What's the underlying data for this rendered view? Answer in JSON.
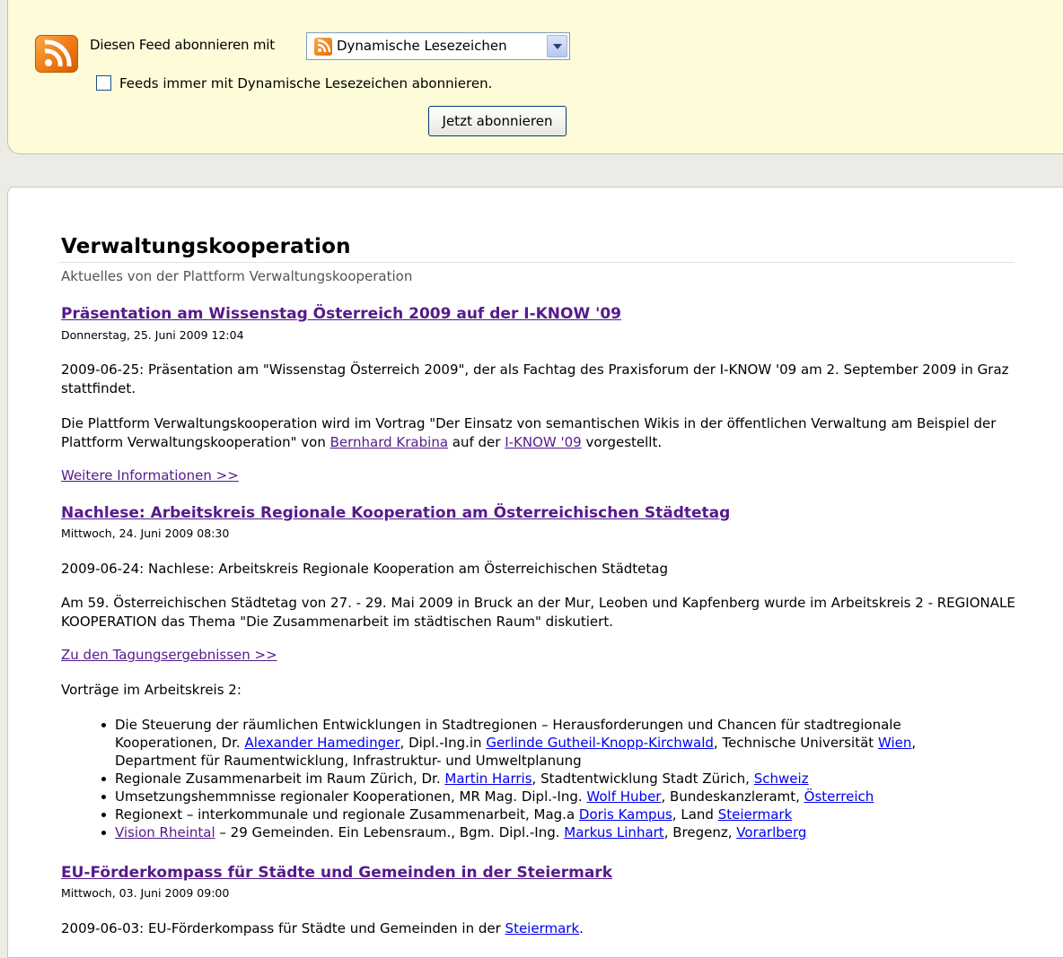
{
  "subscribe": {
    "label": "Diesen Feed abonnieren mit",
    "selected_reader": "Dynamische Lesezeichen",
    "always_label": "Feeds immer mit Dynamische Lesezeichen abonnieren.",
    "button_label": "Jetzt abonnieren"
  },
  "feed": {
    "title": "Verwaltungskooperation",
    "subtitle": "Aktuelles von der Plattform Verwaltungskooperation"
  },
  "entries": [
    {
      "title": "Präsentation am Wissenstag Österreich 2009 auf der I-KNOW '09",
      "date": "Donnerstag, 25. Juni 2009 12:04",
      "p1": "2009-06-25: Präsentation am \"Wissenstag Österreich 2009\", der als Fachtag des Praxisforum der I-KNOW '09 am 2. September 2009 in Graz stattfindet.",
      "p2_a": "Die Plattform Verwaltungskooperation wird im Vortrag \"Der Einsatz von semantischen Wikis in der öffentlichen Verwaltung am Beispiel der Plattform Verwaltungskooperation\" von ",
      "p2_link1": "Bernhard Krabina",
      "p2_b": " auf der ",
      "p2_link2": "I-KNOW '09",
      "p2_c": " vorgestellt.",
      "more_link": "Weitere Informationen >>"
    },
    {
      "title": "Nachlese: Arbeitskreis Regionale Kooperation am Österreichischen Städtetag",
      "date": "Mittwoch, 24. Juni 2009 08:30",
      "p1": "2009-06-24: Nachlese: Arbeitskreis Regionale Kooperation am Österreichischen Städtetag",
      "p2": "Am 59. Österreichischen Städtetag von 27. - 29. Mai 2009 in Bruck an der Mur, Leoben und Kapfenberg wurde im Arbeitskreis 2 - REGIONALE KOOPERATION das Thema \"Die Zusammenarbeit im städtischen Raum\" diskutiert.",
      "results_link": "Zu den Tagungsergebnissen >>",
      "talks_heading": "Vorträge im Arbeitskreis 2:",
      "talks": [
        {
          "a": "Die Steuerung der räumlichen Entwicklungen in Stadtregionen – Herausforderungen und Chancen für stadtregionale Kooperationen, Dr. ",
          "l1": "Alexander Hamedinger",
          "b": ", Dipl.-Ing.in ",
          "l2": "Gerlinde Gutheil-Knopp-Kirchwald",
          "c": ", Technische Universität ",
          "l3": "Wien",
          "d": ", Department für Raumentwicklung, Infrastruktur- und Umweltplanung"
        },
        {
          "a": "Regionale Zusammenarbeit im Raum Zürich, Dr. ",
          "l1": "Martin Harris",
          "b": ", Stadtentwicklung Stadt Zürich, ",
          "l2": "Schweiz"
        },
        {
          "a": "Umsetzungshemmnisse regionaler Kooperationen, MR Mag. Dipl.-Ing. ",
          "l1": "Wolf Huber",
          "b": ", Bundeskanzleramt, ",
          "l2": "Österreich"
        },
        {
          "a": "Regionext – interkommunale und regionale Zusammenarbeit, Mag.a ",
          "l1": "Doris Kampus",
          "b": ", Land ",
          "l2": "Steiermark"
        },
        {
          "l0": "Vision Rheintal",
          "a": " – 29 Gemeinden. Ein Lebensraum., Bgm. Dipl.-Ing. ",
          "l1": "Markus Linhart",
          "b": ", Bregenz, ",
          "l2": "Vorarlberg"
        }
      ]
    },
    {
      "title": "EU-Förderkompass für Städte und Gemeinden in der Steiermark",
      "date": "Mittwoch, 03. Juni 2009 09:00",
      "p1_a": "2009-06-03: EU-Förderkompass für Städte und Gemeinden in der ",
      "p1_link": "Steiermark",
      "p1_b": "."
    }
  ]
}
